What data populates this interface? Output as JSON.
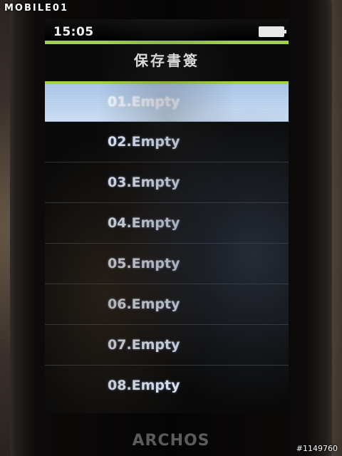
{
  "watermark": {
    "top_left": "MOBILE01",
    "bottom_right": "#1149760"
  },
  "status_bar": {
    "time": "15:05",
    "battery_icon": "battery-full-icon"
  },
  "screen": {
    "title": "保存書簽",
    "items": [
      {
        "label": "01.Empty",
        "selected": true
      },
      {
        "label": "02.Empty",
        "selected": false
      },
      {
        "label": "03.Empty",
        "selected": false
      },
      {
        "label": "04.Empty",
        "selected": false
      },
      {
        "label": "05.Empty",
        "selected": false
      },
      {
        "label": "06.Empty",
        "selected": false
      },
      {
        "label": "07.Empty",
        "selected": false
      },
      {
        "label": "08.Empty",
        "selected": false
      }
    ]
  },
  "device": {
    "brand": "ARCHOS"
  },
  "colors": {
    "accent": "#9fd23c",
    "selection": "#b8d0ee",
    "text": "#dde6f6"
  }
}
